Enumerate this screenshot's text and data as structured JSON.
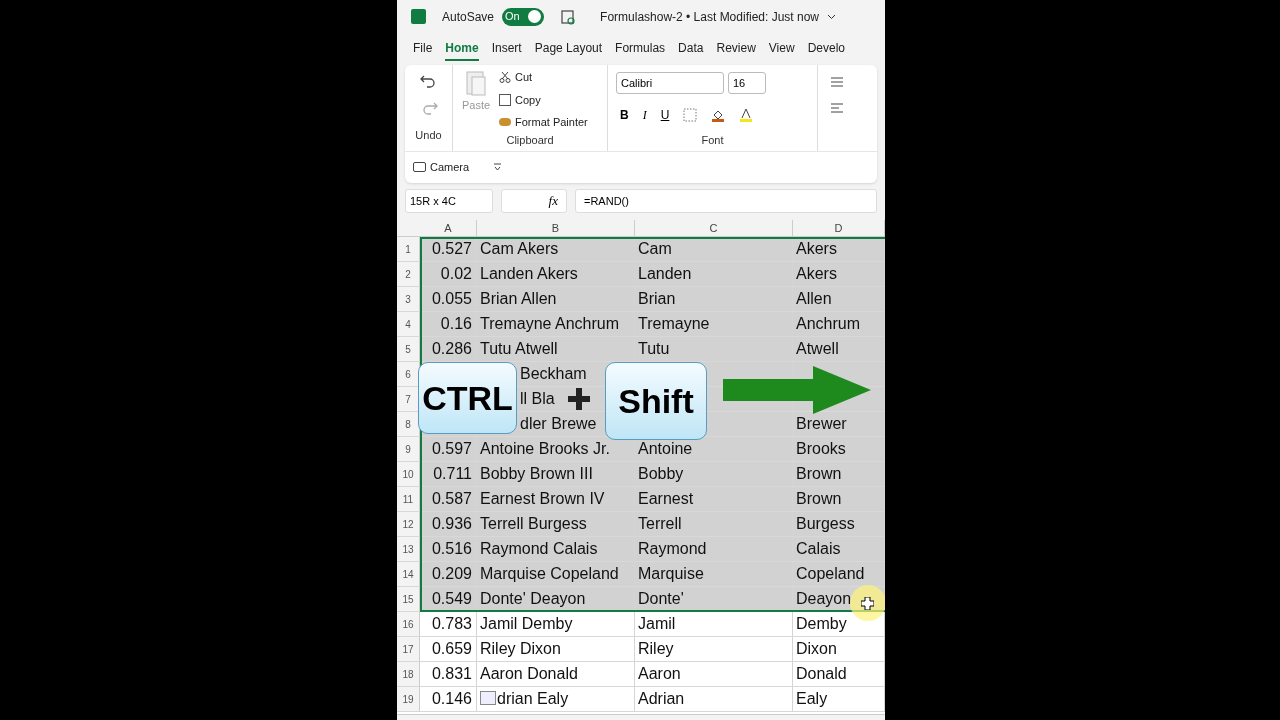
{
  "titlebar": {
    "autosave_label": "AutoSave",
    "autosave_on": true,
    "toggle_text": "On",
    "doc_title": "Formulashow-2 • Last Modified: Just now"
  },
  "tabs": [
    {
      "label": "File",
      "selected": false
    },
    {
      "label": "Home",
      "selected": true
    },
    {
      "label": "Insert",
      "selected": false
    },
    {
      "label": "Page Layout",
      "selected": false
    },
    {
      "label": "Formulas",
      "selected": false
    },
    {
      "label": "Data",
      "selected": false
    },
    {
      "label": "Review",
      "selected": false
    },
    {
      "label": "View",
      "selected": false
    },
    {
      "label": "Develo",
      "selected": false
    }
  ],
  "ribbon": {
    "undo_label": "Undo",
    "paste": "Paste",
    "cut": "Cut",
    "copy": "Copy",
    "format_painter": "Format Painter",
    "clipboard_label": "Clipboard",
    "font_name": "Calibri",
    "font_size": "16",
    "bold": "B",
    "italic": "I",
    "underline": "U",
    "font_label": "Font",
    "camera": "Camera"
  },
  "formula_bar": {
    "name_box": "15R x 4C",
    "fx": "fx",
    "formula": "=RAND()"
  },
  "columns": [
    "A",
    "B",
    "C",
    "D"
  ],
  "rows": [
    {
      "row": "1",
      "selected": true,
      "a": "0.527",
      "b": "Cam Akers",
      "c": "Cam",
      "d": "Akers"
    },
    {
      "row": "2",
      "selected": true,
      "a": "0.02",
      "b": "Landen Akers",
      "c": "Landen",
      "d": "Akers"
    },
    {
      "row": "3",
      "selected": true,
      "a": "0.055",
      "b": "Brian Allen",
      "c": "Brian",
      "d": "Allen"
    },
    {
      "row": "4",
      "selected": true,
      "a": "0.16",
      "b": "Tremayne Anchrum",
      "c": "Tremayne",
      "d": "Anchrum"
    },
    {
      "row": "5",
      "selected": true,
      "a": "0.286",
      "b": "Tutu Atwell",
      "c": "Tutu",
      "d": "Atwell"
    },
    {
      "row": "6",
      "selected": true,
      "b": "Beckham",
      "b_clipped": true
    },
    {
      "row": "7",
      "selected": true,
      "b": "ll Bla",
      "b_clipped": true
    },
    {
      "row": "8",
      "selected": true,
      "b": "dler Brewe",
      "b_clipped": true,
      "d": "Brewer"
    },
    {
      "row": "9",
      "selected": true,
      "a": "0.597",
      "b": "Antoine Brooks Jr.",
      "c": "Antoine",
      "d": "Brooks"
    },
    {
      "row": "10",
      "selected": true,
      "a": "0.711",
      "b": "Bobby Brown III",
      "c": "Bobby",
      "d": "Brown"
    },
    {
      "row": "11",
      "selected": true,
      "a": "0.587",
      "b": "Earnest Brown IV",
      "c": "Earnest",
      "d": "Brown"
    },
    {
      "row": "12",
      "selected": true,
      "a": "0.936",
      "b": "Terrell Burgess",
      "c": "Terrell",
      "d": "Burgess"
    },
    {
      "row": "13",
      "selected": true,
      "a": "0.516",
      "b": "Raymond Calais",
      "c": "Raymond",
      "d": "Calais"
    },
    {
      "row": "14",
      "selected": true,
      "a": "0.209",
      "b": "Marquise Copeland",
      "c": "Marquise",
      "d": "Copeland"
    },
    {
      "row": "15",
      "selected": true,
      "a": "0.549",
      "b": "Donte' Deayon",
      "c": "Donte'",
      "d": "Deayon"
    },
    {
      "row": "16",
      "selected": false,
      "a": "0.783",
      "b": "Jamil Demby",
      "c": "Jamil",
      "d": "Demby"
    },
    {
      "row": "17",
      "selected": false,
      "a": "0.659",
      "b": "Riley Dixon",
      "c": "Riley",
      "d": "Dixon"
    },
    {
      "row": "18",
      "selected": false,
      "a": "0.831",
      "b": "Aaron Donald",
      "c": "Aaron",
      "d": "Donald"
    },
    {
      "row": "19",
      "selected": false,
      "a": "0.146",
      "b": "drian Ealy",
      "b_clipped_small": true,
      "c": "Adrian",
      "d": "Ealy"
    }
  ],
  "overlay": {
    "key1": "CTRL",
    "key2": "Shift"
  }
}
